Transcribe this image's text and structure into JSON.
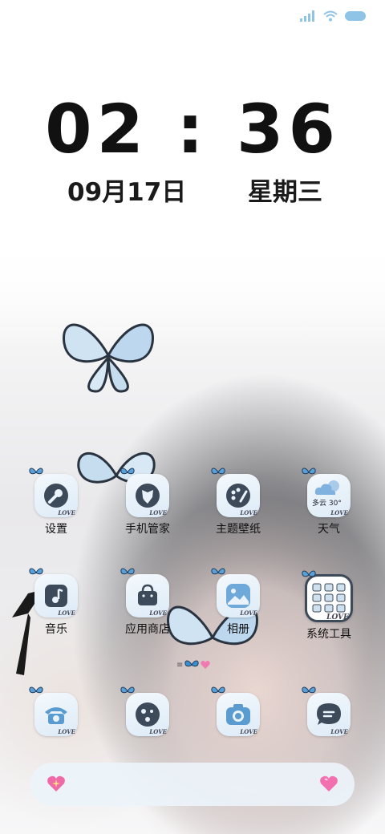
{
  "status": {
    "icons": [
      "signal-icon",
      "wifi-icon",
      "battery-icon"
    ]
  },
  "lockscreen": {
    "time": "02 : 36",
    "date": "09月17日",
    "weekday": "星期三"
  },
  "apps": [
    {
      "name": "settings",
      "label": "设置",
      "icon": "wrench-icon"
    },
    {
      "name": "phone-manager",
      "label": "手机管家",
      "icon": "shield-icon"
    },
    {
      "name": "themes",
      "label": "主题壁纸",
      "icon": "palette-icon"
    },
    {
      "name": "weather",
      "label": "天气",
      "icon": "cloud-sun-icon",
      "widget_text": "多云 30°"
    },
    {
      "name": "music",
      "label": "音乐",
      "icon": "music-note-icon"
    },
    {
      "name": "app-store",
      "label": "应用商店",
      "icon": "shopping-bag-icon"
    },
    {
      "name": "gallery",
      "label": "相册",
      "icon": "image-icon"
    },
    {
      "name": "system-tools",
      "label": "系统工具",
      "icon": "folder-grid-icon"
    }
  ],
  "icon_badge_text": "LOVE",
  "dock": [
    {
      "name": "dock-phone",
      "icon": "telephone-icon"
    },
    {
      "name": "dock-browser",
      "icon": "browser-icon"
    },
    {
      "name": "dock-camera",
      "icon": "camera-icon"
    },
    {
      "name": "dock-messages",
      "icon": "message-icon"
    }
  ],
  "colors": {
    "accent_blue": "#8fc4e6",
    "icon_dark": "#3d4a5a",
    "text": "#111111"
  }
}
